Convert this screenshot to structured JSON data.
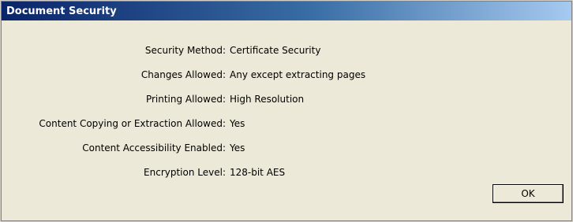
{
  "window": {
    "title": "Document Security"
  },
  "fields": [
    {
      "label": "Security Method:",
      "value": "Certificate Security"
    },
    {
      "label": "Changes Allowed:",
      "value": "Any except extracting pages"
    },
    {
      "label": "Printing Allowed:",
      "value": "High Resolution"
    },
    {
      "label": "Content Copying or Extraction Allowed:",
      "value": "Yes"
    },
    {
      "label": "Content Accessibility Enabled:",
      "value": "Yes"
    },
    {
      "label": "Encryption Level:",
      "value": "128-bit AES"
    }
  ],
  "buttons": {
    "ok_label": "OK"
  },
  "colors": {
    "titlebar_start": "#0a246a",
    "titlebar_end": "#a6caf0",
    "dialog_background": "#ece9d8"
  }
}
